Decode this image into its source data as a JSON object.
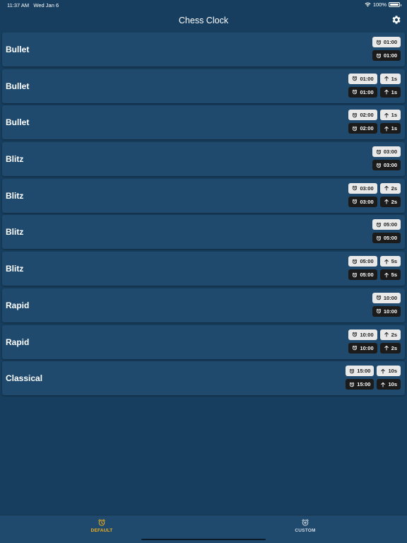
{
  "status_bar": {
    "time": "11:37 AM",
    "date": "Wed Jan 6",
    "battery": "100%"
  },
  "nav": {
    "title": "Chess Clock",
    "settings_icon": "gear-icon"
  },
  "presets": [
    {
      "label": "Bullet",
      "time": "01:00",
      "increment": ""
    },
    {
      "label": "Bullet",
      "time": "01:00",
      "increment": "1s"
    },
    {
      "label": "Bullet",
      "time": "02:00",
      "increment": "1s"
    },
    {
      "label": "Blitz",
      "time": "03:00",
      "increment": ""
    },
    {
      "label": "Blitz",
      "time": "03:00",
      "increment": "2s"
    },
    {
      "label": "Blitz",
      "time": "05:00",
      "increment": ""
    },
    {
      "label": "Blitz",
      "time": "05:00",
      "increment": "5s"
    },
    {
      "label": "Rapid",
      "time": "10:00",
      "increment": ""
    },
    {
      "label": "Rapid",
      "time": "10:00",
      "increment": "2s"
    },
    {
      "label": "Classical",
      "time": "15:00",
      "increment": "10s"
    }
  ],
  "tabs": [
    {
      "label": "DEFAULT",
      "icon": "alarm-clock-icon",
      "active": true
    },
    {
      "label": "CUSTOM",
      "icon": "alarm-clock-plus-icon",
      "active": false
    }
  ],
  "colors": {
    "background": "#173e5e",
    "row": "#1f4a6e",
    "active_tab": "#f2b01e",
    "badge_light": "#e9e9e9",
    "badge_dark": "#1b1b1b"
  }
}
